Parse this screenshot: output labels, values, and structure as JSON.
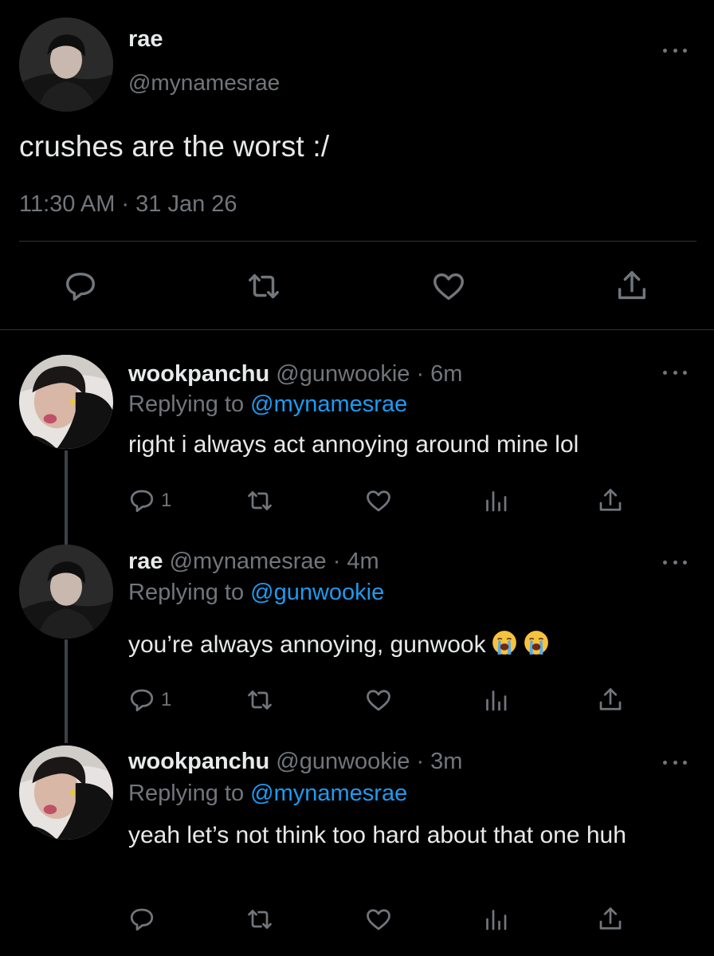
{
  "main_tweet": {
    "name": "rae",
    "handle": "@mynamesrae",
    "text": "crushes are the worst :/",
    "meta": "11:30 AM · 31 Jan 26",
    "avatar_icon": "profile-photo",
    "more_icon": "ellipsis-icon"
  },
  "replies": [
    {
      "name": "wookpanchu",
      "handle_time": " @gunwookie · 6m",
      "replying_prefix": "Replying to ",
      "replying_to": "@mynamesrae",
      "text": "right i always act annoying around mine lol",
      "reply_count": "1"
    },
    {
      "name": "rae",
      "handle_time": " @mynamesrae · 4m",
      "replying_prefix": "Replying to ",
      "replying_to": "@gunwookie",
      "text": "you’re always annoying, gunwook",
      "emojis": [
        "loudly-crying-face",
        "loudly-crying-face"
      ],
      "reply_count": "1"
    },
    {
      "name": "wookpanchu",
      "handle_time": " @gunwookie · 3m",
      "replying_prefix": "Replying to ",
      "replying_to": "@mynamesrae",
      "text": "yeah let’s not think too hard about that one huh",
      "reply_count": ""
    }
  ],
  "colors": {
    "background": "#000000",
    "text": "#e7e9ea",
    "muted": "#71767b",
    "link": "#1d9bf0",
    "divider": "#2f3336"
  }
}
